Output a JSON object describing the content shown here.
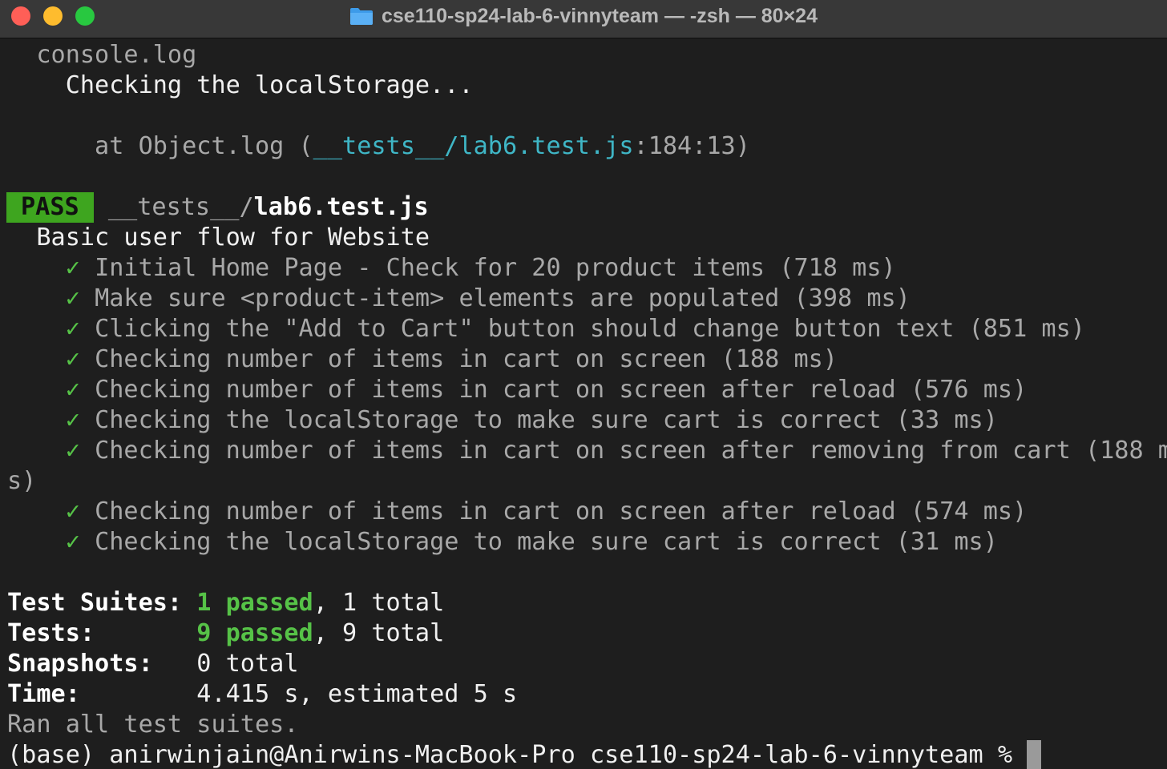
{
  "window": {
    "title": "cse110-sp24-lab-6-vinnyteam — -zsh — 80×24",
    "icon": "folder-icon"
  },
  "console": {
    "header": "  console.log",
    "message": "    Checking the localStorage...",
    "at_prefix": "      at Object.log (",
    "at_path": "__tests__/lab6.test.js",
    "at_suffix": ":184:13)"
  },
  "result": {
    "badge": "PASS",
    "path_dir": " __tests__/",
    "path_file": "lab6.test.js",
    "suite_name": "  Basic user flow for Website"
  },
  "tests": {
    "check_glyph": "✓",
    "items": [
      "Initial Home Page - Check for 20 product items (718 ms)",
      "Make sure <product-item> elements are populated (398 ms)",
      "Clicking the \"Add to Cart\" button should change button text (851 ms)",
      "Checking number of items in cart on screen (188 ms)",
      "Checking number of items in cart on screen after reload (576 ms)",
      "Checking the localStorage to make sure cart is correct (33 ms)",
      "Checking number of items in cart on screen after removing from cart (188 m",
      "Checking number of items in cart on screen after reload (574 ms)",
      "Checking the localStorage to make sure cart is correct (31 ms)"
    ],
    "wrap_continuation": "s)"
  },
  "summary": {
    "suites_label": "Test Suites: ",
    "suites_passed": "1 passed",
    "suites_total": ", 1 total",
    "tests_label": "Tests:       ",
    "tests_passed": "9 passed",
    "tests_total": ", 9 total",
    "snapshots_label": "Snapshots:   ",
    "snapshots_value": "0 total",
    "time_label": "Time:        ",
    "time_value": "4.415 s, estimated 5 s",
    "ran_all": "Ran all test suites."
  },
  "prompt": {
    "text": "(base) anirwinjain@Anirwins-MacBook-Pro cse110-sp24-lab-6-vinnyteam % "
  },
  "colors": {
    "background": "#1e1e1e",
    "pass_badge": "#3ea51f",
    "passed_green": "#56c247",
    "path_cyan": "#3fb6c6"
  }
}
